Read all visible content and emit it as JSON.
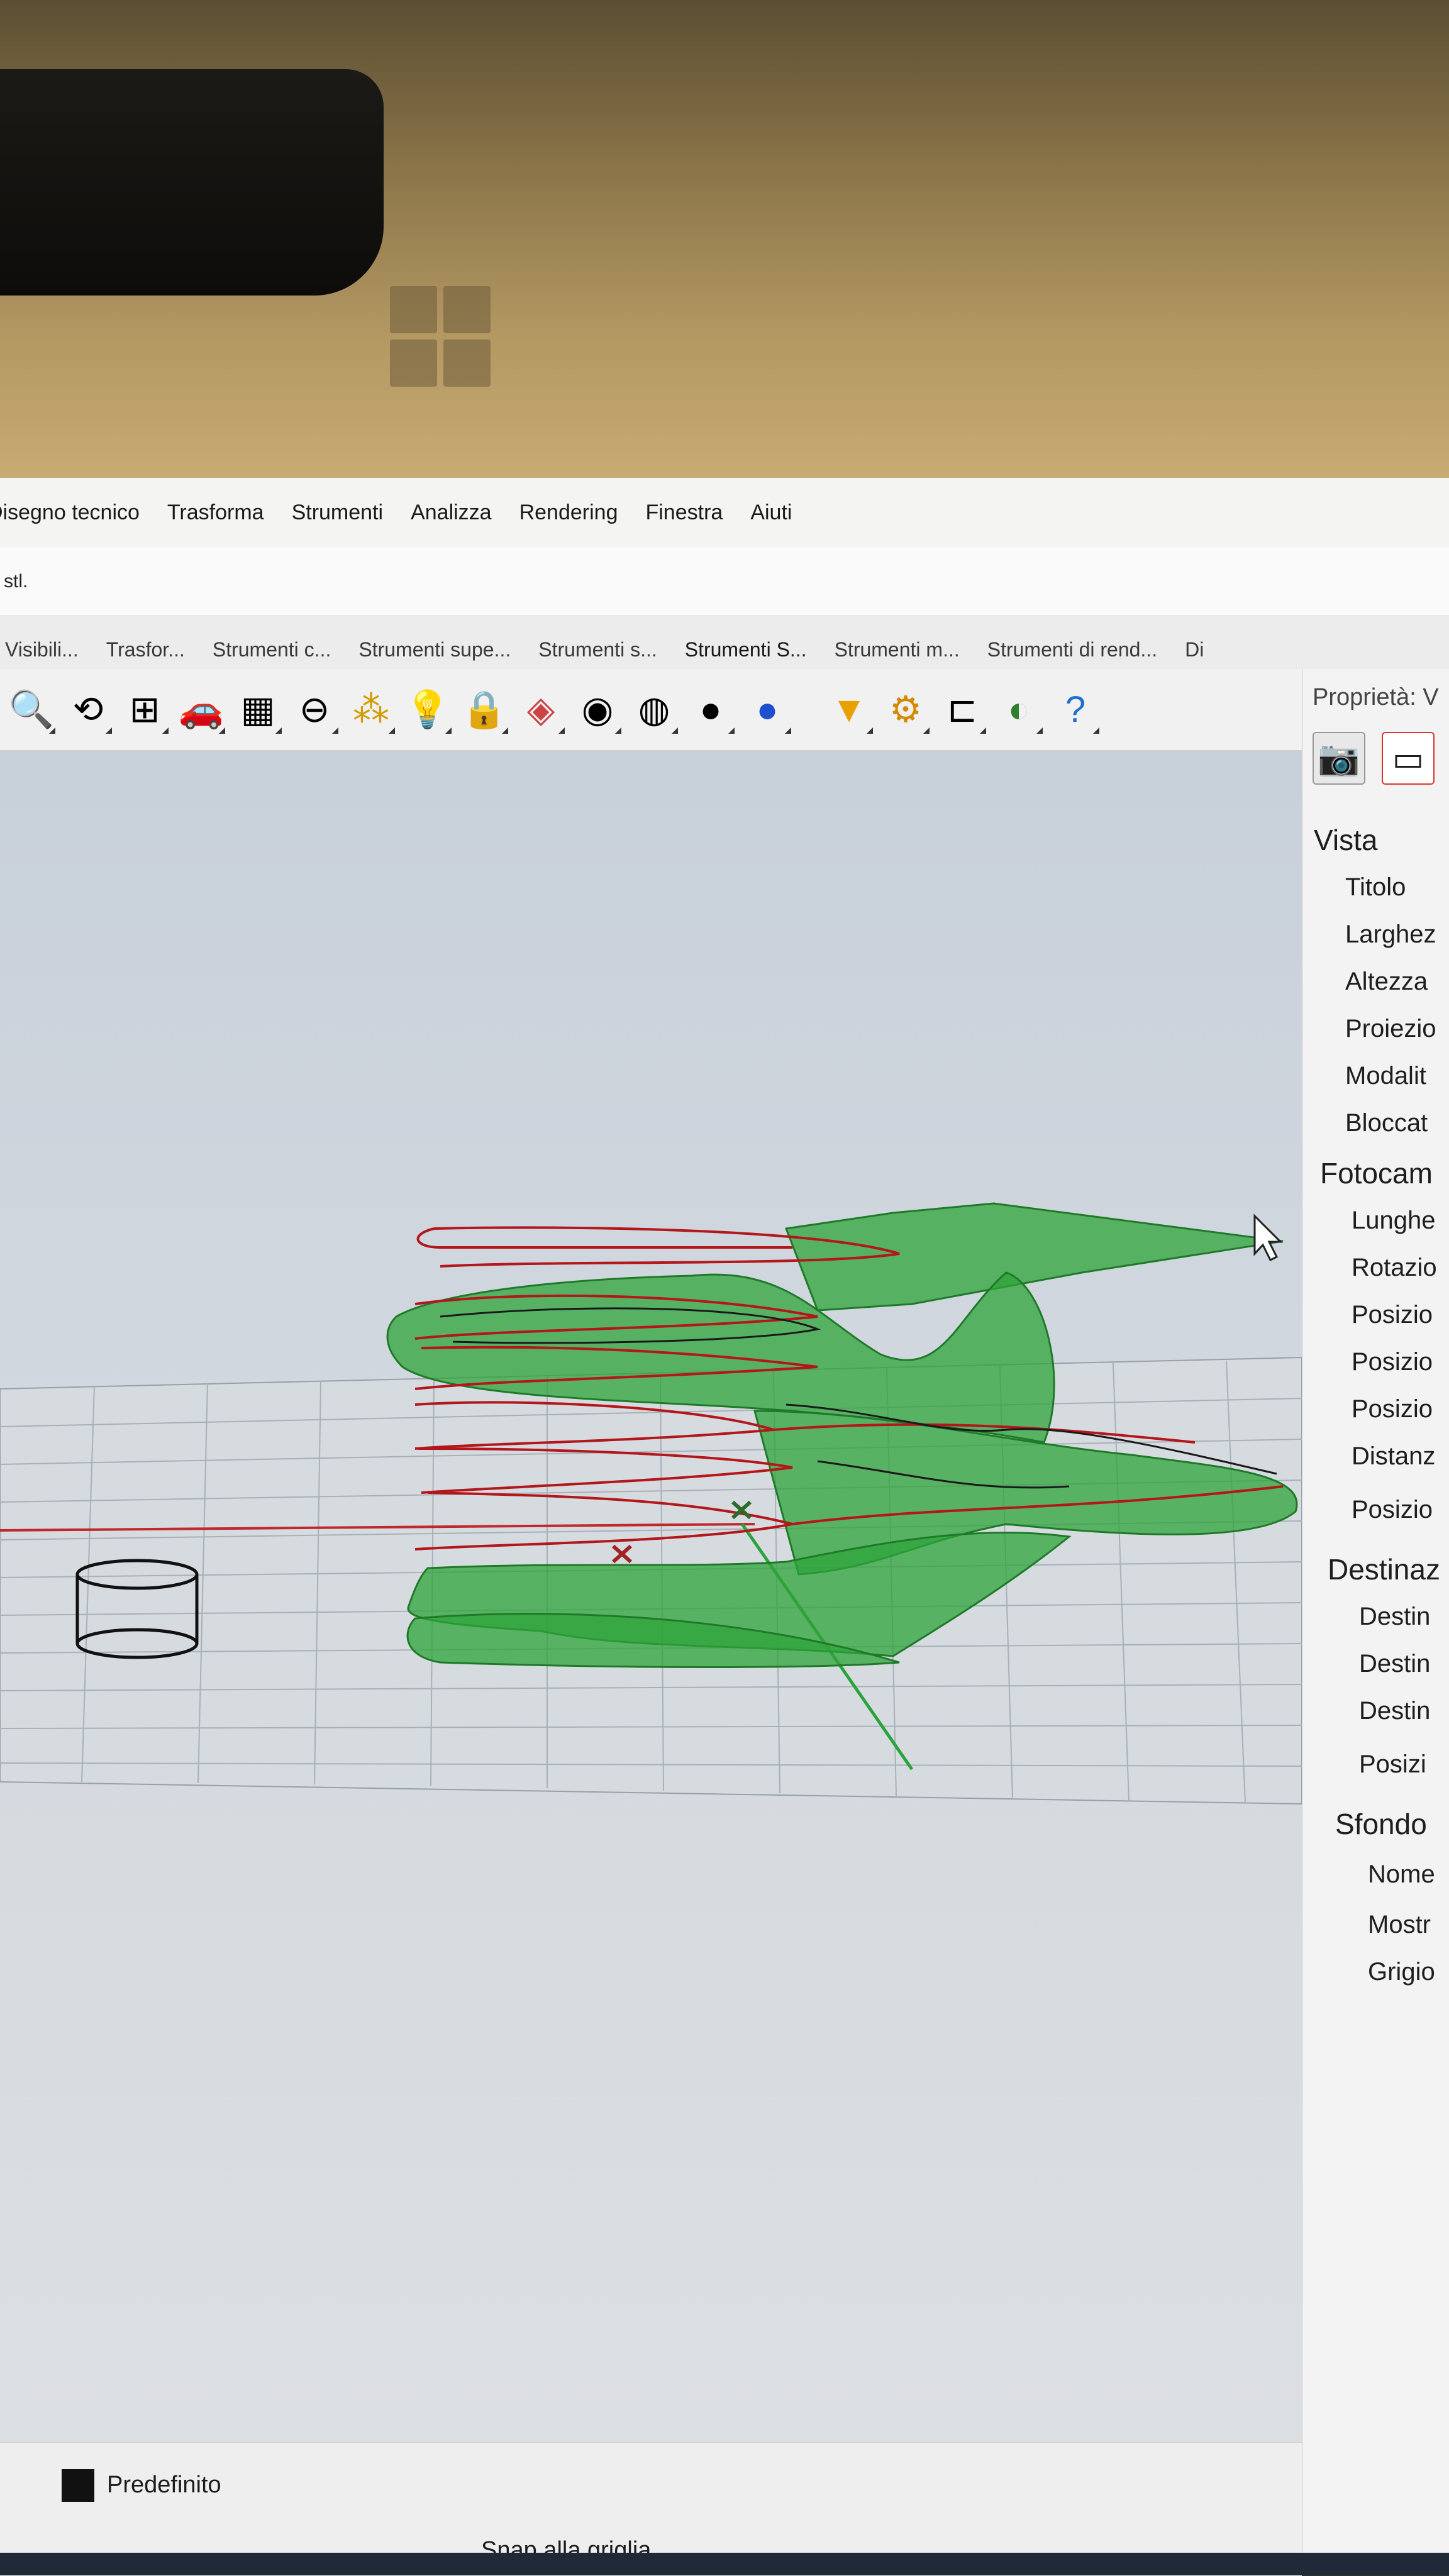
{
  "menubar": {
    "items": [
      "Disegno tecnico",
      "Trasforma",
      "Strumenti",
      "Analizza",
      "Rendering",
      "Finestra",
      "Aiuti"
    ]
  },
  "command_line": {
    "text": "stl."
  },
  "toolbar_tabs": [
    "Visibili...",
    "Trasfor...",
    "Strumenti c...",
    "Strumenti supe...",
    "Strumenti s...",
    "Strumenti S...",
    "Strumenti m...",
    "Strumenti di rend...",
    "Di"
  ],
  "toolbar_icons": [
    "zoom-icon",
    "rotate-view-icon",
    "viewport-layout-icon",
    "car-icon",
    "grid-icon",
    "snap-icon",
    "nodes-icon",
    "lightbulb-icon",
    "lock-icon",
    "shaded-box-icon",
    "color-wheel-icon",
    "wire-sphere-icon",
    "shaded-sphere-icon",
    "render-sphere-icon",
    "cone-icon",
    "gear-cluster-icon",
    "graph-icon",
    "ball-icon",
    "help-icon"
  ],
  "properties": {
    "title": "Proprietà: V",
    "sections": [
      {
        "label": "Vista",
        "fields": [
          "Titolo",
          "Larghez",
          "Altezza",
          "Proiezio",
          "Modalit",
          "Bloccat"
        ]
      },
      {
        "label": "Fotocam",
        "fields": [
          "Lunghe",
          "Rotazio",
          "Posizio",
          "Posizio",
          "Posizio",
          "Distanz",
          "Posizio"
        ]
      },
      {
        "label": "Destinaz",
        "fields": [
          "Destin",
          "Destin",
          "Destin",
          "Posizi"
        ]
      },
      {
        "label": "Sfondo",
        "fields": [
          "Nome",
          "Mostr",
          "Grigio"
        ]
      }
    ]
  },
  "status": {
    "layer": "Predefinito",
    "snap": "Snap alla griglia"
  },
  "colors": {
    "surface_green": "#2ea43a",
    "curve_red": "#b3171b",
    "grid": "#a8b0b8"
  }
}
